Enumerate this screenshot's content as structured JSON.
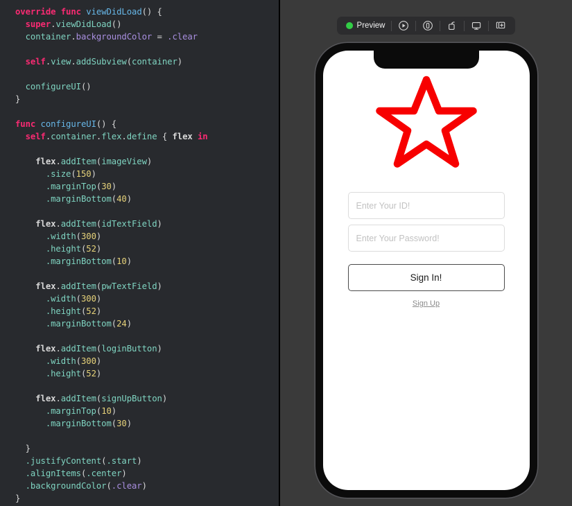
{
  "editor": {
    "language": "swift",
    "lines": [
      [
        {
          "t": "override",
          "c": "kw"
        },
        {
          "t": " ",
          "c": "pl"
        },
        {
          "t": "func",
          "c": "kw"
        },
        {
          "t": " ",
          "c": "pl"
        },
        {
          "t": "viewDidLoad",
          "c": "fn"
        },
        {
          "t": "() {",
          "c": "pl"
        }
      ],
      [
        {
          "t": "  ",
          "c": "pl"
        },
        {
          "t": "super",
          "c": "kw"
        },
        {
          "t": ".",
          "c": "pl"
        },
        {
          "t": "viewDidLoad",
          "c": "id"
        },
        {
          "t": "()",
          "c": "pl"
        }
      ],
      [
        {
          "t": "  ",
          "c": "pl"
        },
        {
          "t": "container",
          "c": "id"
        },
        {
          "t": ".",
          "c": "pl"
        },
        {
          "t": "backgroundColor",
          "c": "prop"
        },
        {
          "t": " = ",
          "c": "pl"
        },
        {
          "t": ".clear",
          "c": "prop"
        }
      ],
      [],
      [
        {
          "t": "  ",
          "c": "pl"
        },
        {
          "t": "self",
          "c": "kw"
        },
        {
          "t": ".",
          "c": "pl"
        },
        {
          "t": "view",
          "c": "id"
        },
        {
          "t": ".",
          "c": "pl"
        },
        {
          "t": "addSubview",
          "c": "id"
        },
        {
          "t": "(",
          "c": "pl"
        },
        {
          "t": "container",
          "c": "id"
        },
        {
          "t": ")",
          "c": "pl"
        }
      ],
      [],
      [
        {
          "t": "  ",
          "c": "pl"
        },
        {
          "t": "configureUI",
          "c": "id"
        },
        {
          "t": "()",
          "c": "pl"
        }
      ],
      [
        {
          "t": "}",
          "c": "pl"
        }
      ],
      [],
      [
        {
          "t": "func",
          "c": "kw"
        },
        {
          "t": " ",
          "c": "pl"
        },
        {
          "t": "configureUI",
          "c": "fn"
        },
        {
          "t": "() {",
          "c": "pl"
        }
      ],
      [
        {
          "t": "  ",
          "c": "pl"
        },
        {
          "t": "self",
          "c": "kw"
        },
        {
          "t": ".",
          "c": "pl"
        },
        {
          "t": "container",
          "c": "id"
        },
        {
          "t": ".",
          "c": "pl"
        },
        {
          "t": "flex",
          "c": "id"
        },
        {
          "t": ".",
          "c": "pl"
        },
        {
          "t": "define",
          "c": "id"
        },
        {
          "t": " { ",
          "c": "pl"
        },
        {
          "t": "flex",
          "c": "b pl"
        },
        {
          "t": " ",
          "c": "pl"
        },
        {
          "t": "in",
          "c": "kw"
        }
      ],
      [],
      [
        {
          "t": "    ",
          "c": "pl"
        },
        {
          "t": "flex",
          "c": "b pl"
        },
        {
          "t": ".",
          "c": "pl"
        },
        {
          "t": "addItem",
          "c": "id"
        },
        {
          "t": "(",
          "c": "pl"
        },
        {
          "t": "imageView",
          "c": "id"
        },
        {
          "t": ")",
          "c": "pl"
        }
      ],
      [
        {
          "t": "      ",
          "c": "pl"
        },
        {
          "t": ".size",
          "c": "id"
        },
        {
          "t": "(",
          "c": "pl"
        },
        {
          "t": "150",
          "c": "num"
        },
        {
          "t": ")",
          "c": "pl"
        }
      ],
      [
        {
          "t": "      ",
          "c": "pl"
        },
        {
          "t": ".marginTop",
          "c": "id"
        },
        {
          "t": "(",
          "c": "pl"
        },
        {
          "t": "30",
          "c": "num"
        },
        {
          "t": ")",
          "c": "pl"
        }
      ],
      [
        {
          "t": "      ",
          "c": "pl"
        },
        {
          "t": ".marginBottom",
          "c": "id"
        },
        {
          "t": "(",
          "c": "pl"
        },
        {
          "t": "40",
          "c": "num"
        },
        {
          "t": ")",
          "c": "pl"
        }
      ],
      [],
      [
        {
          "t": "    ",
          "c": "pl"
        },
        {
          "t": "flex",
          "c": "b pl"
        },
        {
          "t": ".",
          "c": "pl"
        },
        {
          "t": "addItem",
          "c": "id"
        },
        {
          "t": "(",
          "c": "pl"
        },
        {
          "t": "idTextField",
          "c": "id"
        },
        {
          "t": ")",
          "c": "pl"
        }
      ],
      [
        {
          "t": "      ",
          "c": "pl"
        },
        {
          "t": ".width",
          "c": "id"
        },
        {
          "t": "(",
          "c": "pl"
        },
        {
          "t": "300",
          "c": "num"
        },
        {
          "t": ")",
          "c": "pl"
        }
      ],
      [
        {
          "t": "      ",
          "c": "pl"
        },
        {
          "t": ".height",
          "c": "id"
        },
        {
          "t": "(",
          "c": "pl"
        },
        {
          "t": "52",
          "c": "num"
        },
        {
          "t": ")",
          "c": "pl"
        }
      ],
      [
        {
          "t": "      ",
          "c": "pl"
        },
        {
          "t": ".marginBottom",
          "c": "id"
        },
        {
          "t": "(",
          "c": "pl"
        },
        {
          "t": "10",
          "c": "num"
        },
        {
          "t": ")",
          "c": "pl"
        }
      ],
      [],
      [
        {
          "t": "    ",
          "c": "pl"
        },
        {
          "t": "flex",
          "c": "b pl"
        },
        {
          "t": ".",
          "c": "pl"
        },
        {
          "t": "addItem",
          "c": "id"
        },
        {
          "t": "(",
          "c": "pl"
        },
        {
          "t": "pwTextField",
          "c": "id"
        },
        {
          "t": ")",
          "c": "pl"
        }
      ],
      [
        {
          "t": "      ",
          "c": "pl"
        },
        {
          "t": ".width",
          "c": "id"
        },
        {
          "t": "(",
          "c": "pl"
        },
        {
          "t": "300",
          "c": "num"
        },
        {
          "t": ")",
          "c": "pl"
        }
      ],
      [
        {
          "t": "      ",
          "c": "pl"
        },
        {
          "t": ".height",
          "c": "id"
        },
        {
          "t": "(",
          "c": "pl"
        },
        {
          "t": "52",
          "c": "num"
        },
        {
          "t": ")",
          "c": "pl"
        }
      ],
      [
        {
          "t": "      ",
          "c": "pl"
        },
        {
          "t": ".marginBottom",
          "c": "id"
        },
        {
          "t": "(",
          "c": "pl"
        },
        {
          "t": "24",
          "c": "num"
        },
        {
          "t": ")",
          "c": "pl"
        }
      ],
      [],
      [
        {
          "t": "    ",
          "c": "pl"
        },
        {
          "t": "flex",
          "c": "b pl"
        },
        {
          "t": ".",
          "c": "pl"
        },
        {
          "t": "addItem",
          "c": "id"
        },
        {
          "t": "(",
          "c": "pl"
        },
        {
          "t": "loginButton",
          "c": "id"
        },
        {
          "t": ")",
          "c": "pl"
        }
      ],
      [
        {
          "t": "      ",
          "c": "pl"
        },
        {
          "t": ".width",
          "c": "id"
        },
        {
          "t": "(",
          "c": "pl"
        },
        {
          "t": "300",
          "c": "num"
        },
        {
          "t": ")",
          "c": "pl"
        }
      ],
      [
        {
          "t": "      ",
          "c": "pl"
        },
        {
          "t": ".height",
          "c": "id"
        },
        {
          "t": "(",
          "c": "pl"
        },
        {
          "t": "52",
          "c": "num"
        },
        {
          "t": ")",
          "c": "pl"
        }
      ],
      [],
      [
        {
          "t": "    ",
          "c": "pl"
        },
        {
          "t": "flex",
          "c": "b pl"
        },
        {
          "t": ".",
          "c": "pl"
        },
        {
          "t": "addItem",
          "c": "id"
        },
        {
          "t": "(",
          "c": "pl"
        },
        {
          "t": "signUpButton",
          "c": "id"
        },
        {
          "t": ")",
          "c": "pl"
        }
      ],
      [
        {
          "t": "      ",
          "c": "pl"
        },
        {
          "t": ".marginTop",
          "c": "id"
        },
        {
          "t": "(",
          "c": "pl"
        },
        {
          "t": "10",
          "c": "num"
        },
        {
          "t": ")",
          "c": "pl"
        }
      ],
      [
        {
          "t": "      ",
          "c": "pl"
        },
        {
          "t": ".marginBottom",
          "c": "id"
        },
        {
          "t": "(",
          "c": "pl"
        },
        {
          "t": "30",
          "c": "num"
        },
        {
          "t": ")",
          "c": "pl"
        }
      ],
      [],
      [
        {
          "t": "  ",
          "c": "pl"
        },
        {
          "t": "}",
          "c": "pl"
        }
      ],
      [
        {
          "t": "  ",
          "c": "pl"
        },
        {
          "t": ".justifyContent",
          "c": "id"
        },
        {
          "t": "(",
          "c": "pl"
        },
        {
          "t": ".start",
          "c": "id"
        },
        {
          "t": ")",
          "c": "pl"
        }
      ],
      [
        {
          "t": "  ",
          "c": "pl"
        },
        {
          "t": ".alignItems",
          "c": "id"
        },
        {
          "t": "(",
          "c": "pl"
        },
        {
          "t": ".center",
          "c": "id"
        },
        {
          "t": ")",
          "c": "pl"
        }
      ],
      [
        {
          "t": "  ",
          "c": "pl"
        },
        {
          "t": ".backgroundColor",
          "c": "id"
        },
        {
          "t": "(",
          "c": "pl"
        },
        {
          "t": ".clear",
          "c": "prop"
        },
        {
          "t": ")",
          "c": "pl"
        }
      ],
      [
        {
          "t": "}",
          "c": "pl"
        }
      ]
    ]
  },
  "toolbar": {
    "status_label": "Preview",
    "status_color": "#32cd46",
    "buttons": [
      {
        "name": "play-icon",
        "title": "Play"
      },
      {
        "name": "stop-icon",
        "title": "Stop"
      },
      {
        "name": "rotate-icon",
        "title": "Rotate"
      },
      {
        "name": "display-icon",
        "title": "Display"
      },
      {
        "name": "add-device-icon",
        "title": "Add Device"
      }
    ]
  },
  "phone": {
    "logo": {
      "name": "star-icon",
      "color": "#f70000",
      "size": 150
    },
    "id_field": {
      "placeholder": "Enter Your ID!",
      "value": ""
    },
    "password_field": {
      "placeholder": "Enter Your Password!",
      "value": ""
    },
    "sign_in_button": {
      "label": "Sign In!"
    },
    "sign_up_link": {
      "label": "Sign Up"
    }
  }
}
